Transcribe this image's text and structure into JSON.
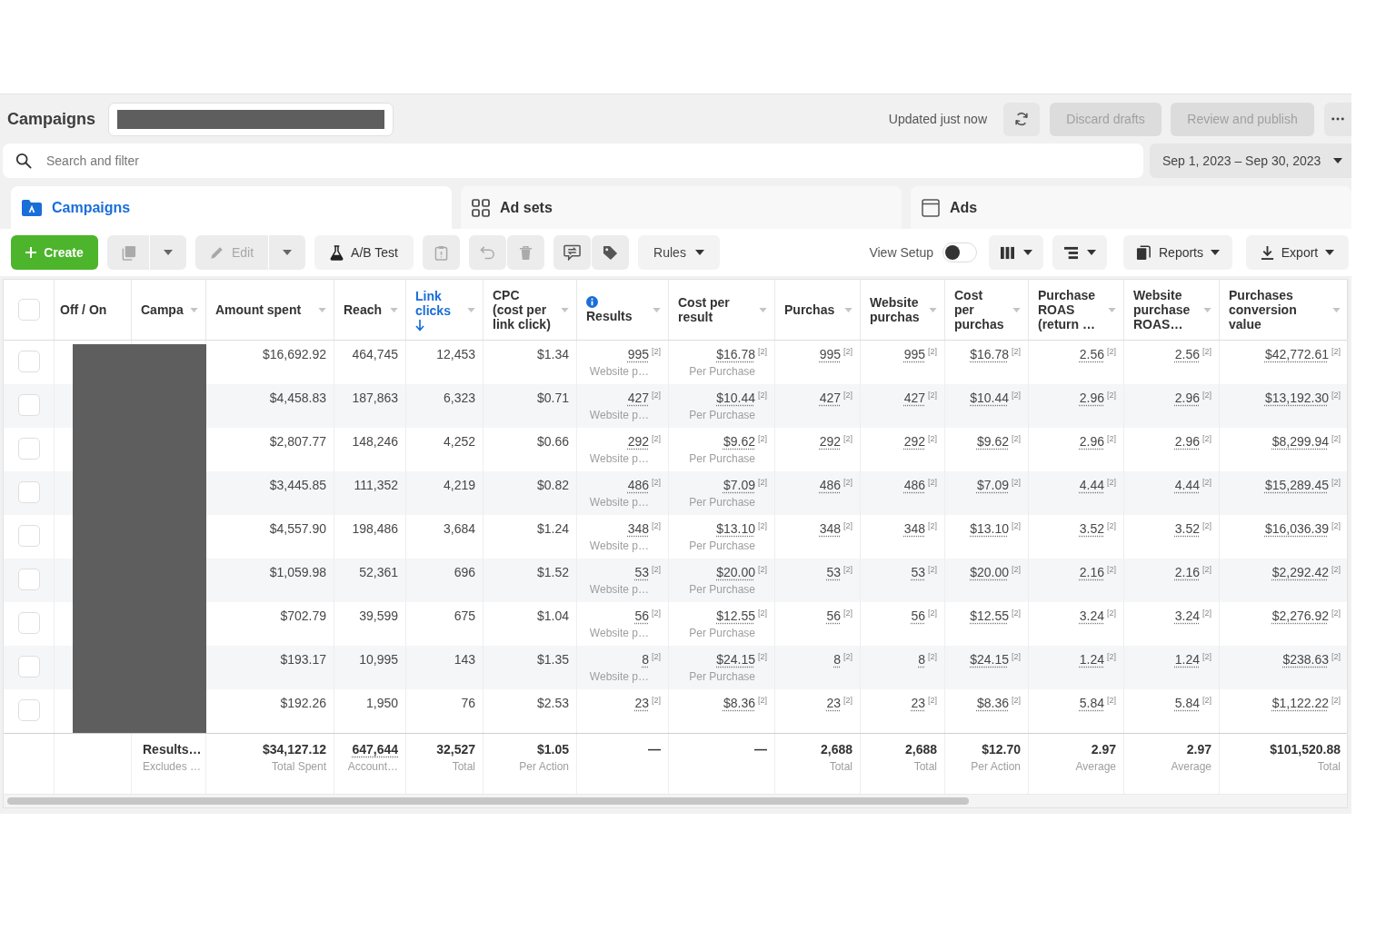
{
  "header": {
    "title": "Campaigns",
    "status": "Updated just now",
    "discard": {
      "label": "Discard drafts",
      "disabled": true
    },
    "publish": {
      "label": "Review and publish",
      "disabled": true
    }
  },
  "search": {
    "placeholder": "Search and filter"
  },
  "date_range": {
    "label": "Sep 1, 2023 – Sep 30, 2023"
  },
  "tabs": [
    {
      "label": "Campaigns",
      "selected": true
    },
    {
      "label": "Ad sets",
      "selected": false
    },
    {
      "label": "Ads",
      "selected": false
    }
  ],
  "toolbar": {
    "create": {
      "label": "Create"
    },
    "duplicate": {
      "disabled": true
    },
    "edit": {
      "label": "Edit",
      "disabled": true
    },
    "ab_test": {
      "label": "A/B Test"
    },
    "actions": [
      {
        "disabled": true
      },
      {
        "disabled": true
      },
      {
        "disabled": true
      },
      {
        "disabled": false
      },
      {
        "disabled": false
      }
    ],
    "rules": {
      "label": "Rules"
    },
    "view_setup": {
      "label": "View Setup",
      "on": false
    },
    "reports": {
      "label": "Reports"
    },
    "export": {
      "label": "Export"
    }
  },
  "table": {
    "select_all": {
      "checked": false
    },
    "columns": [
      {
        "kind": "text",
        "label": "Off / On"
      },
      {
        "kind": "menu",
        "label": "Campa",
        "sorted": false
      },
      {
        "kind": "menu",
        "label": "Amount spent",
        "sorted": false
      },
      {
        "kind": "menu",
        "label": "Reach",
        "sorted": false
      },
      {
        "kind": "menu",
        "label": "Link clicks",
        "sorted": true
      },
      {
        "kind": "menu",
        "label": "CPC (cost per link click)",
        "sorted": false
      },
      {
        "kind": "info",
        "label": "Results",
        "sorted": false
      },
      {
        "kind": "menu",
        "label": "Cost per result",
        "sorted": false
      },
      {
        "kind": "menu",
        "label": "Purchas",
        "sorted": false
      },
      {
        "kind": "menu",
        "label": "Website purchas",
        "sorted": false
      },
      {
        "kind": "menu",
        "label": "Cost per purchas",
        "sorted": false
      },
      {
        "kind": "menu",
        "label": "Purchase ROAS (return …",
        "sorted": false
      },
      {
        "kind": "menu",
        "label": "Website purchase ROAS…",
        "sorted": false
      },
      {
        "kind": "menu",
        "label": "Purchases conversion value",
        "sorted": false
      }
    ],
    "rows": [
      {
        "selected": false,
        "cells": [
          {},
          {},
          {
            "value": "$16,692.92"
          },
          {
            "value": "464,745"
          },
          {
            "value": "12,453"
          },
          {
            "value": "$1.34"
          },
          {
            "value": "995",
            "note": "[2]",
            "sub": "Website p…",
            "dotted": true
          },
          {
            "value": "$16.78",
            "note": "[2]",
            "sub": "Per Purchase",
            "dotted": true
          },
          {
            "value": "995",
            "note": "[2]",
            "dotted": true
          },
          {
            "value": "995",
            "note": "[2]",
            "dotted": true
          },
          {
            "value": "$16.78",
            "note": "[2]",
            "dotted": true
          },
          {
            "value": "2.56",
            "note": "[2]",
            "dotted": true
          },
          {
            "value": "2.56",
            "note": "[2]",
            "dotted": true
          },
          {
            "value": "$42,772.61",
            "note": "[2]",
            "dotted": true
          }
        ]
      },
      {
        "selected": false,
        "cells": [
          {},
          {},
          {
            "value": "$4,458.83"
          },
          {
            "value": "187,863"
          },
          {
            "value": "6,323"
          },
          {
            "value": "$0.71"
          },
          {
            "value": "427",
            "note": "[2]",
            "sub": "Website p…",
            "dotted": true
          },
          {
            "value": "$10.44",
            "note": "[2]",
            "sub": "Per Purchase",
            "dotted": true
          },
          {
            "value": "427",
            "note": "[2]",
            "dotted": true
          },
          {
            "value": "427",
            "note": "[2]",
            "dotted": true
          },
          {
            "value": "$10.44",
            "note": "[2]",
            "dotted": true
          },
          {
            "value": "2.96",
            "note": "[2]",
            "dotted": true
          },
          {
            "value": "2.96",
            "note": "[2]",
            "dotted": true
          },
          {
            "value": "$13,192.30",
            "note": "[2]",
            "dotted": true
          }
        ]
      },
      {
        "selected": false,
        "cells": [
          {},
          {},
          {
            "value": "$2,807.77"
          },
          {
            "value": "148,246"
          },
          {
            "value": "4,252"
          },
          {
            "value": "$0.66"
          },
          {
            "value": "292",
            "note": "[2]",
            "sub": "Website p…",
            "dotted": true
          },
          {
            "value": "$9.62",
            "note": "[2]",
            "sub": "Per Purchase",
            "dotted": true
          },
          {
            "value": "292",
            "note": "[2]",
            "dotted": true
          },
          {
            "value": "292",
            "note": "[2]",
            "dotted": true
          },
          {
            "value": "$9.62",
            "note": "[2]",
            "dotted": true
          },
          {
            "value": "2.96",
            "note": "[2]",
            "dotted": true
          },
          {
            "value": "2.96",
            "note": "[2]",
            "dotted": true
          },
          {
            "value": "$8,299.94",
            "note": "[2]",
            "dotted": true
          }
        ]
      },
      {
        "selected": false,
        "cells": [
          {},
          {},
          {
            "value": "$3,445.85"
          },
          {
            "value": "111,352"
          },
          {
            "value": "4,219"
          },
          {
            "value": "$0.82"
          },
          {
            "value": "486",
            "note": "[2]",
            "sub": "Website p…",
            "dotted": true
          },
          {
            "value": "$7.09",
            "note": "[2]",
            "sub": "Per Purchase",
            "dotted": true
          },
          {
            "value": "486",
            "note": "[2]",
            "dotted": true
          },
          {
            "value": "486",
            "note": "[2]",
            "dotted": true
          },
          {
            "value": "$7.09",
            "note": "[2]",
            "dotted": true
          },
          {
            "value": "4.44",
            "note": "[2]",
            "dotted": true
          },
          {
            "value": "4.44",
            "note": "[2]",
            "dotted": true
          },
          {
            "value": "$15,289.45",
            "note": "[2]",
            "dotted": true
          }
        ]
      },
      {
        "selected": false,
        "cells": [
          {},
          {},
          {
            "value": "$4,557.90"
          },
          {
            "value": "198,486"
          },
          {
            "value": "3,684"
          },
          {
            "value": "$1.24"
          },
          {
            "value": "348",
            "note": "[2]",
            "sub": "Website p…",
            "dotted": true
          },
          {
            "value": "$13.10",
            "note": "[2]",
            "sub": "Per Purchase",
            "dotted": true
          },
          {
            "value": "348",
            "note": "[2]",
            "dotted": true
          },
          {
            "value": "348",
            "note": "[2]",
            "dotted": true
          },
          {
            "value": "$13.10",
            "note": "[2]",
            "dotted": true
          },
          {
            "value": "3.52",
            "note": "[2]",
            "dotted": true
          },
          {
            "value": "3.52",
            "note": "[2]",
            "dotted": true
          },
          {
            "value": "$16,036.39",
            "note": "[2]",
            "dotted": true
          }
        ]
      },
      {
        "selected": false,
        "cells": [
          {},
          {},
          {
            "value": "$1,059.98"
          },
          {
            "value": "52,361"
          },
          {
            "value": "696"
          },
          {
            "value": "$1.52"
          },
          {
            "value": "53",
            "note": "[2]",
            "sub": "Website p…",
            "dotted": true
          },
          {
            "value": "$20.00",
            "note": "[2]",
            "sub": "Per Purchase",
            "dotted": true
          },
          {
            "value": "53",
            "note": "[2]",
            "dotted": true
          },
          {
            "value": "53",
            "note": "[2]",
            "dotted": true
          },
          {
            "value": "$20.00",
            "note": "[2]",
            "dotted": true
          },
          {
            "value": "2.16",
            "note": "[2]",
            "dotted": true
          },
          {
            "value": "2.16",
            "note": "[2]",
            "dotted": true
          },
          {
            "value": "$2,292.42",
            "note": "[2]",
            "dotted": true
          }
        ]
      },
      {
        "selected": false,
        "cells": [
          {},
          {},
          {
            "value": "$702.79"
          },
          {
            "value": "39,599"
          },
          {
            "value": "675"
          },
          {
            "value": "$1.04"
          },
          {
            "value": "56",
            "note": "[2]",
            "sub": "Website p…",
            "dotted": true
          },
          {
            "value": "$12.55",
            "note": "[2]",
            "sub": "Per Purchase",
            "dotted": true
          },
          {
            "value": "56",
            "note": "[2]",
            "dotted": true
          },
          {
            "value": "56",
            "note": "[2]",
            "dotted": true
          },
          {
            "value": "$12.55",
            "note": "[2]",
            "dotted": true
          },
          {
            "value": "3.24",
            "note": "[2]",
            "dotted": true
          },
          {
            "value": "3.24",
            "note": "[2]",
            "dotted": true
          },
          {
            "value": "$2,276.92",
            "note": "[2]",
            "dotted": true
          }
        ]
      },
      {
        "selected": false,
        "cells": [
          {},
          {},
          {
            "value": "$193.17"
          },
          {
            "value": "10,995"
          },
          {
            "value": "143"
          },
          {
            "value": "$1.35"
          },
          {
            "value": "8",
            "note": "[2]",
            "sub": "Website p…",
            "dotted": true
          },
          {
            "value": "$24.15",
            "note": "[2]",
            "sub": "Per Purchase",
            "dotted": true
          },
          {
            "value": "8",
            "note": "[2]",
            "dotted": true
          },
          {
            "value": "8",
            "note": "[2]",
            "dotted": true
          },
          {
            "value": "$24.15",
            "note": "[2]",
            "dotted": true
          },
          {
            "value": "1.24",
            "note": "[2]",
            "dotted": true
          },
          {
            "value": "1.24",
            "note": "[2]",
            "dotted": true
          },
          {
            "value": "$238.63",
            "note": "[2]",
            "dotted": true
          }
        ]
      },
      {
        "selected": false,
        "cells": [
          {},
          {},
          {
            "value": "$192.26"
          },
          {
            "value": "1,950"
          },
          {
            "value": "76"
          },
          {
            "value": "$2.53"
          },
          {
            "value": "23",
            "note": "[2]",
            "dotted": true
          },
          {
            "value": "$8.36",
            "note": "[2]",
            "dotted": true
          },
          {
            "value": "23",
            "note": "[2]",
            "dotted": true
          },
          {
            "value": "23",
            "note": "[2]",
            "dotted": true
          },
          {
            "value": "$8.36",
            "note": "[2]",
            "dotted": true
          },
          {
            "value": "5.84",
            "note": "[2]",
            "dotted": true
          },
          {
            "value": "5.84",
            "note": "[2]",
            "dotted": true
          },
          {
            "value": "$1,122.22",
            "note": "[2]",
            "dotted": true
          }
        ]
      }
    ],
    "totals": [
      {
        "value": "Results…",
        "sub": "Excludes …"
      },
      {
        "value": "$34,127.12",
        "sub": "Total Spent"
      },
      {
        "value": "647,644",
        "sub": "Account…",
        "dotted": true
      },
      {
        "value": "32,527",
        "sub": "Total"
      },
      {
        "value": "$1.05",
        "sub": "Per Action"
      },
      {
        "value": "—"
      },
      {
        "value": "—"
      },
      {
        "value": "2,688",
        "sub": "Total"
      },
      {
        "value": "2,688",
        "sub": "Total"
      },
      {
        "value": "$12.70",
        "sub": "Per Action"
      },
      {
        "value": "2.97",
        "sub": "Average"
      },
      {
        "value": "2.97",
        "sub": "Average"
      },
      {
        "value": "$101,520.88",
        "sub": "Total"
      }
    ]
  }
}
